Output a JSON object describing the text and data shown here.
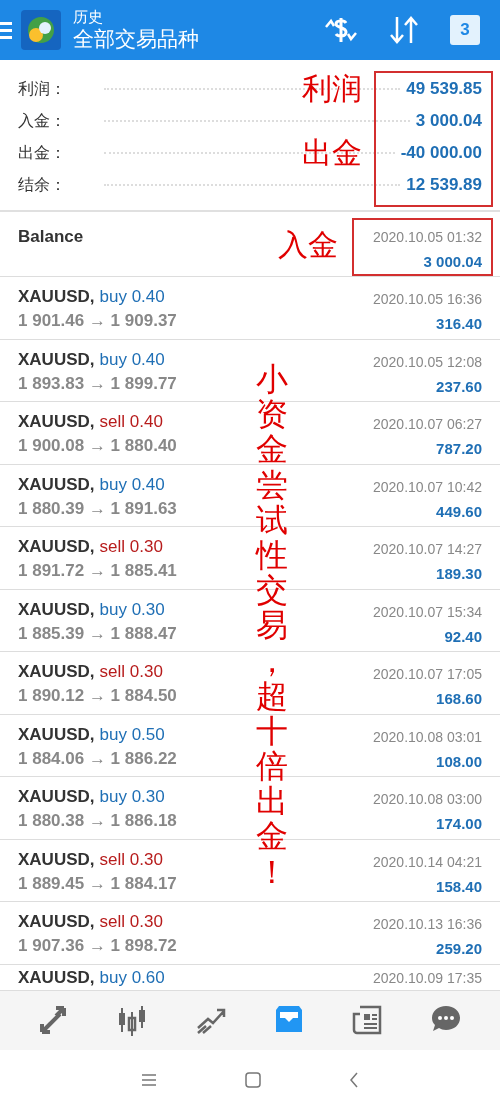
{
  "header": {
    "title": "历史",
    "subtitle": "全部交易品种",
    "calendar_day": "3"
  },
  "summary": [
    {
      "label": "利润：",
      "value": "49 539.85"
    },
    {
      "label": "入金：",
      "value": "3 000.04"
    },
    {
      "label": "出金：",
      "value": "-40 000.00"
    },
    {
      "label": "结余：",
      "value": "12 539.89"
    }
  ],
  "balance": {
    "label": "Balance",
    "time": "2020.10.05 01:32",
    "amount": "3 000.04"
  },
  "trades": [
    {
      "symbol": "XAUUSD,",
      "kind": "buy",
      "order": "buy 0.40",
      "prices": "1 901.46 → 1 909.37",
      "time": "2020.10.05 16:36",
      "profit": "316.40"
    },
    {
      "symbol": "XAUUSD,",
      "kind": "buy",
      "order": "buy 0.40",
      "prices": "1 893.83 → 1 899.77",
      "time": "2020.10.05 12:08",
      "profit": "237.60"
    },
    {
      "symbol": "XAUUSD,",
      "kind": "sell",
      "order": "sell 0.40",
      "prices": "1 900.08 → 1 880.40",
      "time": "2020.10.07 06:27",
      "profit": "787.20"
    },
    {
      "symbol": "XAUUSD,",
      "kind": "buy",
      "order": "buy 0.40",
      "prices": "1 880.39 → 1 891.63",
      "time": "2020.10.07 10:42",
      "profit": "449.60"
    },
    {
      "symbol": "XAUUSD,",
      "kind": "sell",
      "order": "sell 0.30",
      "prices": "1 891.72 → 1 885.41",
      "time": "2020.10.07 14:27",
      "profit": "189.30"
    },
    {
      "symbol": "XAUUSD,",
      "kind": "buy",
      "order": "buy 0.30",
      "prices": "1 885.39 → 1 888.47",
      "time": "2020.10.07 15:34",
      "profit": "92.40"
    },
    {
      "symbol": "XAUUSD,",
      "kind": "sell",
      "order": "sell 0.30",
      "prices": "1 890.12 → 1 884.50",
      "time": "2020.10.07 17:05",
      "profit": "168.60"
    },
    {
      "symbol": "XAUUSD,",
      "kind": "buy",
      "order": "buy 0.50",
      "prices": "1 884.06 → 1 886.22",
      "time": "2020.10.08 03:01",
      "profit": "108.00"
    },
    {
      "symbol": "XAUUSD,",
      "kind": "buy",
      "order": "buy 0.30",
      "prices": "1 880.38 → 1 886.18",
      "time": "2020.10.08 03:00",
      "profit": "174.00"
    },
    {
      "symbol": "XAUUSD,",
      "kind": "sell",
      "order": "sell 0.30",
      "prices": "1 889.45 → 1 884.17",
      "time": "2020.10.14 04:21",
      "profit": "158.40"
    },
    {
      "symbol": "XAUUSD,",
      "kind": "sell",
      "order": "sell 0.30",
      "prices": "1 907.36 → 1 898.72",
      "time": "2020.10.13 16:36",
      "profit": "259.20"
    }
  ],
  "partial_trade": {
    "symbol": "XAUUSD,",
    "kind": "buy",
    "order": "buy 0.60",
    "time": "2020.10.09 17:35"
  },
  "annotations": {
    "profit_label": "利润",
    "withdraw_label": "出金",
    "deposit_label": "入金",
    "note": "小资金尝试性交易，超十倍出金！"
  },
  "nav": [
    {
      "kind": "trade",
      "selected": false
    },
    {
      "kind": "chart",
      "selected": false
    },
    {
      "kind": "trend",
      "selected": false
    },
    {
      "kind": "history",
      "selected": true
    },
    {
      "kind": "news",
      "selected": false
    },
    {
      "kind": "chat",
      "selected": false
    }
  ]
}
